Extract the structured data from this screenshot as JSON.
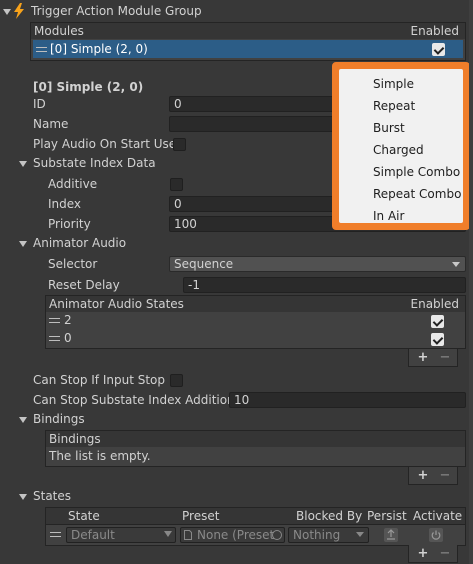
{
  "group_title": "Trigger Action Module Group",
  "modules": {
    "header": "Modules",
    "enabled_header": "Enabled",
    "items": [
      {
        "label": "[0] Simple (2, 0)",
        "enabled": true
      }
    ]
  },
  "selected": {
    "title": "[0] Simple (2, 0)",
    "id_label": "ID",
    "id_value": "0",
    "name_label": "Name",
    "name_value": "",
    "play_audio_label": "Play Audio On Start Use"
  },
  "substate": {
    "title": "Substate Index Data",
    "additive_label": "Additive",
    "index_label": "Index",
    "index_value": "0",
    "priority_label": "Priority",
    "priority_value": "100"
  },
  "animator_audio": {
    "title": "Animator Audio",
    "selector_label": "Selector",
    "selector_value": "Sequence",
    "reset_delay_label": "Reset Delay",
    "reset_delay_value": "-1",
    "states_header": "Animator Audio States",
    "enabled_header": "Enabled",
    "states": [
      {
        "label": "2",
        "enabled": true
      },
      {
        "label": "0",
        "enabled": true
      }
    ]
  },
  "stop": {
    "can_stop_label": "Can Stop If Input Stop",
    "substate_add_label": "Can Stop Substate Index Addition",
    "substate_add_value": "10"
  },
  "bindings": {
    "title": "Bindings",
    "header": "Bindings",
    "empty_text": "The list is empty."
  },
  "states": {
    "title": "States",
    "columns": [
      "State",
      "Preset",
      "Blocked By",
      "Persist",
      "Activate"
    ],
    "row": {
      "state": "Default",
      "preset": "None (Preset",
      "blocked_by": "Nothing"
    }
  },
  "list_buttons": {
    "add": "+",
    "remove": "−"
  },
  "dropdown_menu": {
    "items": [
      "Simple",
      "Repeat",
      "Burst",
      "Charged",
      "Simple Combo",
      "Repeat Combo",
      "In Air"
    ]
  },
  "colors": {
    "accent_outline": "#f07e2a",
    "selected_row": "#2c5d87",
    "lightning_icon": "#f7a21b"
  }
}
